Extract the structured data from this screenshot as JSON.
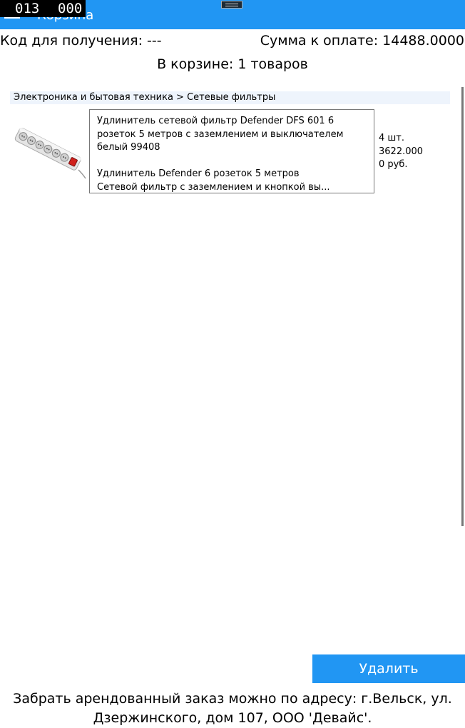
{
  "header": {
    "title": "Корзина",
    "counter_left": "013",
    "counter_right": "000"
  },
  "order": {
    "code_label": "Код для получения: ---",
    "sum_label": "Сумма к оплате: 14488.0000",
    "cart_count": "В корзине: 1 товаров"
  },
  "cart": {
    "category": "Электроника и бытовая техника > Сетевые фильтры",
    "items": [
      {
        "title": "Удлинитель сетевой фильтр Defender DFS 601 6 розеток 5 метров с заземлением и выключателем белый 99408",
        "subtitle": "Удлинитель Defender 6 розеток 5 метров",
        "description": "Сетевой фильтр с заземлением и кнопкой вы...",
        "quantity": "4 шт.",
        "price": "3622.000",
        "currency_line": "0 руб."
      }
    ]
  },
  "actions": {
    "delete_label": "Удалить"
  },
  "footer": {
    "pickup_text": "Забрать арендованный заказ можно по адресу: г.Вельск, ул. Дзержинского, дом 107, ООО 'Девайс'."
  },
  "colors": {
    "accent": "#2196f3",
    "category_background": "#eef4fc"
  }
}
